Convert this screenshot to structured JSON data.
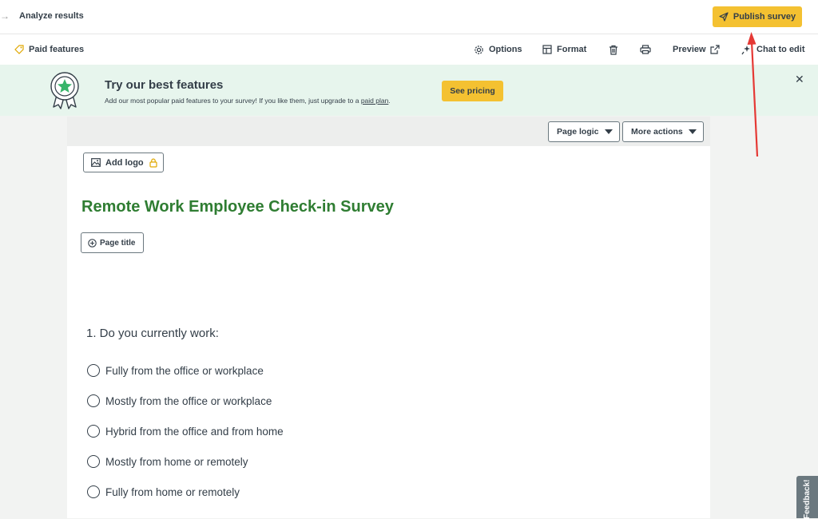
{
  "topbar": {
    "breadcrumb_label": "Analyze results",
    "publish_label": "Publish survey"
  },
  "toolbar": {
    "paid_features": "Paid features",
    "options": "Options",
    "format": "Format",
    "preview": "Preview",
    "chat_to_edit": "Chat to edit"
  },
  "banner": {
    "title": "Try our best features",
    "text": "Add our most popular paid features to your survey! If you like them, just upgrade to a",
    "link": "paid plan",
    "period": ".",
    "pricing_label": "See pricing"
  },
  "canvas": {
    "page_logic": "Page logic",
    "more_actions": "More actions",
    "add_logo": "Add logo",
    "survey_title": "Remote Work Employee Check-in Survey",
    "page_title_btn": "Page title"
  },
  "question": {
    "text": "1. Do you currently work:",
    "options": [
      "Fully from the office or workplace",
      "Mostly from the office or workplace",
      "Hybrid from the office and from home",
      "Mostly from home or remotely",
      "Fully from home or remotely"
    ]
  },
  "feedback_label": "Feedback!",
  "colors": {
    "accent": "#f4c131",
    "brand_green": "#2f7d32",
    "banner_bg": "#e7f5ed",
    "annotation_arrow": "#e53935"
  }
}
